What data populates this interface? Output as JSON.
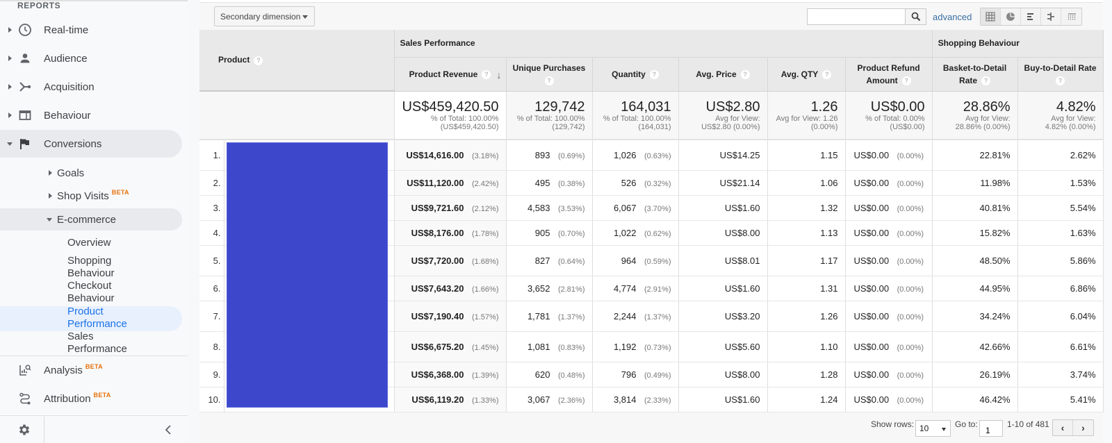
{
  "sidebar": {
    "section_title": "REPORTS",
    "items": [
      {
        "label": "Real-time",
        "icon": "clock-icon"
      },
      {
        "label": "Audience",
        "icon": "person-icon"
      },
      {
        "label": "Acquisition",
        "icon": "acquisition-icon"
      },
      {
        "label": "Behaviour",
        "icon": "behaviour-icon"
      },
      {
        "label": "Conversions",
        "icon": "flag-icon"
      }
    ],
    "conversions_sub": [
      {
        "label": "Goals"
      },
      {
        "label": "Shop Visits",
        "badge": "BETA"
      },
      {
        "label": "E-commerce"
      }
    ],
    "ecommerce_leaves": [
      {
        "label": "Overview"
      },
      {
        "label_line1": "Shopping",
        "label_line2": "Behaviour"
      },
      {
        "label_line1": "Checkout",
        "label_line2": "Behaviour"
      },
      {
        "label_line1": "Product",
        "label_line2": "Performance"
      },
      {
        "label_line1": "Sales",
        "label_line2": "Performance"
      }
    ],
    "bottom_items": [
      {
        "label": "Analysis",
        "badge": "BETA",
        "icon": "analysis-icon"
      },
      {
        "label": "Attribution",
        "badge": "BETA",
        "icon": "attribution-icon"
      }
    ],
    "active_leaf": "Product Performance"
  },
  "toolbar": {
    "secondary_dimension": "Secondary dimension",
    "search_value": "",
    "advanced_label": "advanced",
    "view_modes": [
      "table-view-icon",
      "pie-view-icon",
      "performance-view-icon",
      "comparison-view-icon",
      "pivot-view-icon"
    ]
  },
  "table": {
    "primary_dimension": "Product",
    "groups": {
      "sales": "Sales Performance",
      "shopping": "Shopping Behaviour"
    },
    "columns": {
      "revenue": "Product Revenue",
      "unique_purchases": "Unique Purchases",
      "quantity": "Quantity",
      "avg_price": "Avg. Price",
      "avg_qty": "Avg. QTY",
      "refund_line1": "Product Refund",
      "refund_line2": "Amount",
      "basket_line1": "Basket-to-Detail",
      "basket_line2": "Rate",
      "buy_to_detail": "Buy-to-Detail Rate"
    },
    "totals": {
      "revenue": {
        "value": "US$459,420.50",
        "sub1": "% of Total: 100.00%",
        "sub2": "(US$459,420.50)"
      },
      "unique_purchases": {
        "value": "129,742",
        "sub1": "% of Total: 100.00%",
        "sub2": "(129,742)"
      },
      "quantity": {
        "value": "164,031",
        "sub1": "% of Total: 100.00%",
        "sub2": "(164,031)"
      },
      "avg_price": {
        "value": "US$2.80",
        "sub1": "Avg for View:",
        "sub2": "US$2.80 (0.00%)"
      },
      "avg_qty": {
        "value": "1.26",
        "sub1": "Avg for View: 1.26",
        "sub2": "(0.00%)"
      },
      "refund": {
        "value": "US$0.00",
        "sub1": "% of Total: 0.00%",
        "sub2": "(US$0.00)"
      },
      "basket": {
        "value": "28.86%",
        "sub1": "Avg for View:",
        "sub2": "28.86% (0.00%)"
      },
      "buy": {
        "value": "4.82%",
        "sub1": "Avg for View:",
        "sub2": "4.82% (0.00%)"
      }
    },
    "rows": [
      {
        "idx": "1.",
        "revenue": "US$14,616.00",
        "revenue_pct": "(3.18%)",
        "up": "893",
        "up_pct": "(0.69%)",
        "qty": "1,026",
        "qty_pct": "(0.63%)",
        "avg_price": "US$14.25",
        "avg_qty": "1.15",
        "refund": "US$0.00",
        "refund_pct": "(0.00%)",
        "basket": "22.81%",
        "buy": "2.62%"
      },
      {
        "idx": "2.",
        "revenue": "US$11,120.00",
        "revenue_pct": "(2.42%)",
        "up": "495",
        "up_pct": "(0.38%)",
        "qty": "526",
        "qty_pct": "(0.32%)",
        "avg_price": "US$21.14",
        "avg_qty": "1.06",
        "refund": "US$0.00",
        "refund_pct": "(0.00%)",
        "basket": "11.98%",
        "buy": "1.53%"
      },
      {
        "idx": "3.",
        "revenue": "US$9,721.60",
        "revenue_pct": "(2.12%)",
        "up": "4,583",
        "up_pct": "(3.53%)",
        "qty": "6,067",
        "qty_pct": "(3.70%)",
        "avg_price": "US$1.60",
        "avg_qty": "1.32",
        "refund": "US$0.00",
        "refund_pct": "(0.00%)",
        "basket": "40.81%",
        "buy": "5.54%"
      },
      {
        "idx": "4.",
        "revenue": "US$8,176.00",
        "revenue_pct": "(1.78%)",
        "up": "905",
        "up_pct": "(0.70%)",
        "qty": "1,022",
        "qty_pct": "(0.62%)",
        "avg_price": "US$8.00",
        "avg_qty": "1.13",
        "refund": "US$0.00",
        "refund_pct": "(0.00%)",
        "basket": "15.82%",
        "buy": "1.63%"
      },
      {
        "idx": "5.",
        "revenue": "US$7,720.00",
        "revenue_pct": "(1.68%)",
        "up": "827",
        "up_pct": "(0.64%)",
        "qty": "964",
        "qty_pct": "(0.59%)",
        "avg_price": "US$8.01",
        "avg_qty": "1.17",
        "refund": "US$0.00",
        "refund_pct": "(0.00%)",
        "basket": "48.50%",
        "buy": "5.86%"
      },
      {
        "idx": "6.",
        "revenue": "US$7,643.20",
        "revenue_pct": "(1.66%)",
        "up": "3,652",
        "up_pct": "(2.81%)",
        "qty": "4,774",
        "qty_pct": "(2.91%)",
        "avg_price": "US$1.60",
        "avg_qty": "1.31",
        "refund": "US$0.00",
        "refund_pct": "(0.00%)",
        "basket": "44.95%",
        "buy": "6.86%"
      },
      {
        "idx": "7.",
        "revenue": "US$7,190.40",
        "revenue_pct": "(1.57%)",
        "up": "1,781",
        "up_pct": "(1.37%)",
        "qty": "2,244",
        "qty_pct": "(1.37%)",
        "avg_price": "US$3.20",
        "avg_qty": "1.26",
        "refund": "US$0.00",
        "refund_pct": "(0.00%)",
        "basket": "34.24%",
        "buy": "6.04%"
      },
      {
        "idx": "8.",
        "revenue": "US$6,675.20",
        "revenue_pct": "(1.45%)",
        "up": "1,081",
        "up_pct": "(0.83%)",
        "qty": "1,192",
        "qty_pct": "(0.73%)",
        "avg_price": "US$5.60",
        "avg_qty": "1.10",
        "refund": "US$0.00",
        "refund_pct": "(0.00%)",
        "basket": "42.66%",
        "buy": "6.61%"
      },
      {
        "idx": "9.",
        "revenue": "US$6,368.00",
        "revenue_pct": "(1.39%)",
        "up": "620",
        "up_pct": "(0.48%)",
        "qty": "796",
        "qty_pct": "(0.49%)",
        "avg_price": "US$8.00",
        "avg_qty": "1.28",
        "refund": "US$0.00",
        "refund_pct": "(0.00%)",
        "basket": "26.19%",
        "buy": "3.74%"
      },
      {
        "idx": "10.",
        "revenue": "US$6,119.20",
        "revenue_pct": "(1.33%)",
        "up": "3,067",
        "up_pct": "(2.36%)",
        "qty": "3,814",
        "qty_pct": "(2.33%)",
        "avg_price": "US$1.60",
        "avg_qty": "1.24",
        "refund": "US$0.00",
        "refund_pct": "(0.00%)",
        "basket": "46.42%",
        "buy": "5.41%"
      }
    ],
    "redacted_color": "#3d47cc"
  },
  "pager": {
    "show_rows_label": "Show rows:",
    "show_rows_value": "10",
    "goto_label": "Go to:",
    "goto_value": "1",
    "range": "1-10 of 481",
    "prev": "‹",
    "next": "›"
  }
}
